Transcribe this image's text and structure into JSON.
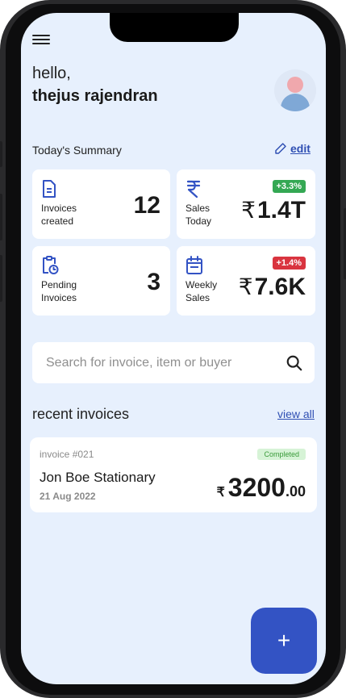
{
  "header": {
    "greeting": "hello,",
    "username": "thejus rajendran"
  },
  "summary": {
    "title": "Today's Summary",
    "edit_label": "edit",
    "cards": [
      {
        "label_line1": "Invoices",
        "label_line2": "created",
        "value": "12",
        "icon": "document-icon"
      },
      {
        "label_line1": "Sales",
        "label_line2": "Today",
        "currency": "₹",
        "value": "1.4T",
        "badge": "+3.3%",
        "badge_color": "#34a853",
        "icon": "rupee-icon"
      },
      {
        "label_line1": "Pending",
        "label_line2": "Invoices",
        "value": "3",
        "icon": "clipboard-clock-icon"
      },
      {
        "label_line1": "Weekly",
        "label_line2": "Sales",
        "currency": "₹",
        "value": "7.6K",
        "badge": "+1.4%",
        "badge_color": "#d9343f",
        "icon": "calendar-icon"
      }
    ]
  },
  "search": {
    "placeholder": "Search for invoice, item or buyer",
    "icon": "search-icon"
  },
  "recent": {
    "title": "recent invoices",
    "view_all_label": "view all",
    "invoices": [
      {
        "number": "invoice #021",
        "status": "Completed",
        "buyer": "Jon Boe Stationary",
        "date": "21 Aug 2022",
        "currency": "₹",
        "amount_main": "3200",
        "amount_decimal": ".00"
      }
    ]
  },
  "fab": {
    "label": "+"
  },
  "colors": {
    "accent": "#2f4fb3",
    "fab": "#3353c4",
    "background": "#e7f0fd"
  }
}
